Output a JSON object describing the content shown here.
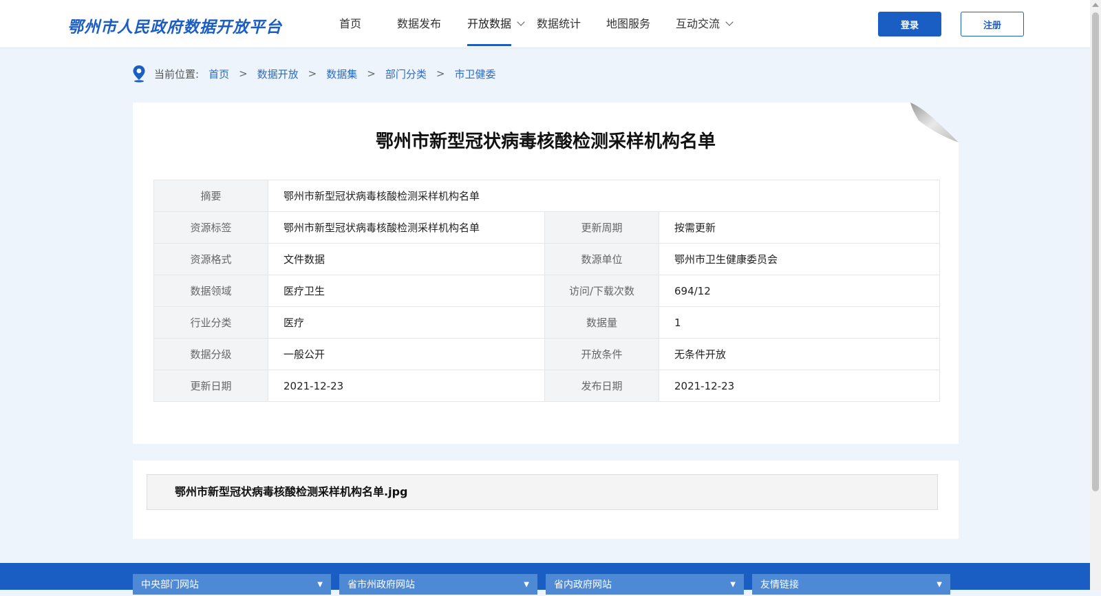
{
  "header": {
    "logo": "鄂州市人民政府数据开放平台",
    "nav": [
      {
        "label": "首页"
      },
      {
        "label": "数据发布"
      },
      {
        "label": "开放数据"
      },
      {
        "label": "数据统计"
      },
      {
        "label": "地图服务"
      },
      {
        "label": "互动交流"
      }
    ],
    "login": "登录",
    "register": "注册",
    "accent_color": "#1a5ec4"
  },
  "breadcrumb": {
    "prefix": "当前位置:",
    "items": [
      "首页",
      "数据开放",
      "数据集",
      "部门分类",
      "市卫健委"
    ],
    "separator": ">"
  },
  "detail": {
    "title": "鄂州市新型冠状病毒核酸检测采样机构名单",
    "summary_label": "摘要",
    "summary_value": "鄂州市新型冠状病毒核酸检测采样机构名单",
    "rows": [
      {
        "l1": "资源标签",
        "v1": "鄂州市新型冠状病毒核酸检测采样机构名单",
        "l2": "更新周期",
        "v2": "按需更新"
      },
      {
        "l1": "资源格式",
        "v1": "文件数据",
        "l2": "数源单位",
        "v2": "鄂州市卫生健康委员会"
      },
      {
        "l1": "数据领域",
        "v1": "医疗卫生",
        "l2": "访问/下载次数",
        "v2": "694/12"
      },
      {
        "l1": "行业分类",
        "v1": "医疗",
        "l2": "数据量",
        "v2": "1"
      },
      {
        "l1": "数据分级",
        "v1": "一般公开",
        "l2": "开放条件",
        "v2": "无条件开放"
      },
      {
        "l1": "更新日期",
        "v1": "2021-12-23",
        "l2": "发布日期",
        "v2": "2021-12-23"
      }
    ]
  },
  "attachment": {
    "filename": "鄂州市新型冠状病毒核酸检测采样机构名单.jpg"
  },
  "footer": {
    "links": [
      "中央部门网站",
      "省市州政府网站",
      "省内政府网站",
      "友情链接"
    ],
    "arrow": "▼"
  }
}
